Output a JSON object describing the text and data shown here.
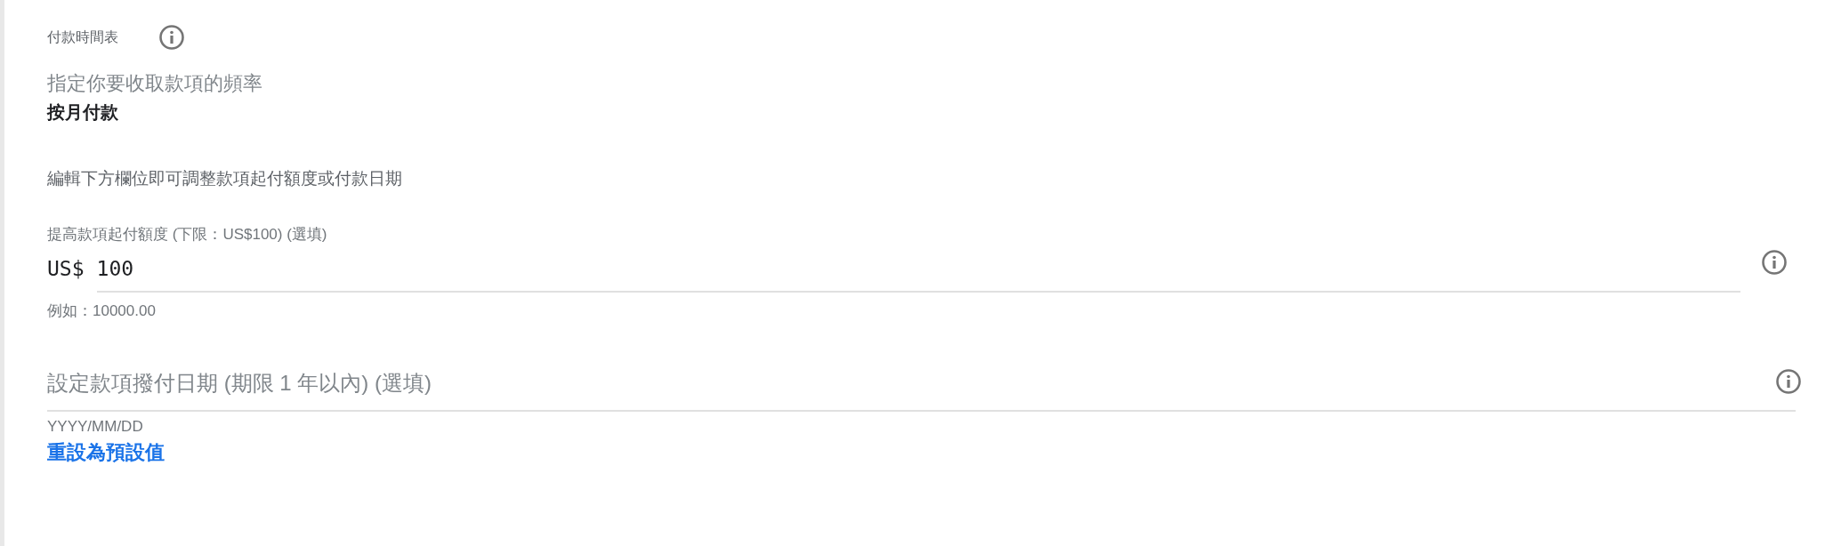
{
  "section": {
    "title": "付款時間表"
  },
  "frequency": {
    "prompt": "指定你要收取款項的頻率",
    "value": "按月付款"
  },
  "instruction": "編輯下方欄位即可調整款項起付額度或付款日期",
  "threshold_field": {
    "label": "提高款項起付額度 (下限：US$100) (選填)",
    "prefix": "US$",
    "value": "100",
    "hint": "例如：10000.00"
  },
  "date_field": {
    "placeholder": "設定款項撥付日期 (期限 1 年以內) (選填)",
    "hint": "YYYY/MM/DD"
  },
  "reset_link": "重設為預設值"
}
